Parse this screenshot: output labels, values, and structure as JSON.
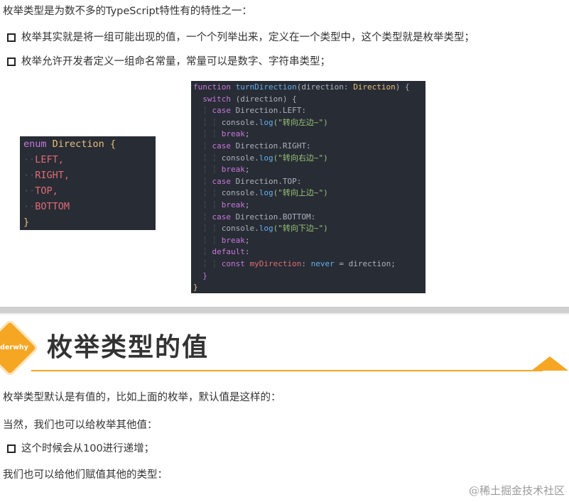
{
  "top": {
    "intro": "枚举类型是为数不多的TypeScript特性有的特性之一：",
    "bullets": [
      "枚举其实就是将一组可能出现的值，一个个列举出来，定义在一个类型中，这个类型就是枚举类型；",
      "枚举允许开发者定义一组命名常量，常量可以是数字、字符串类型；"
    ]
  },
  "code_enum": {
    "keyword": "enum",
    "name": "Direction",
    "open": "{",
    "members": [
      "LEFT,",
      "RIGHT,",
      "TOP,",
      "BOTTOM"
    ],
    "close": "}"
  },
  "code_function": {
    "kw_function": "function",
    "fn_name": "turnDirection",
    "params": "(direction: ",
    "param_type": "Direction",
    "params_end": ") {",
    "kw_switch": "switch",
    "switch_expr": " (direction) {",
    "kw_case": "case",
    "kw_break": "break",
    "kw_default": "default",
    "kw_const": "const",
    "console": "console.",
    "log": "log",
    "cases": [
      {
        "label": "Direction.LEFT:",
        "msg": "(\"转向左边~\")"
      },
      {
        "label": "Direction.RIGHT:",
        "msg": "(\"转向右边~\")"
      },
      {
        "label": "Direction.TOP:",
        "msg": "(\"转向上边~\")"
      },
      {
        "label": "Direction.BOTTOM:",
        "msg": "(\"转向下边~\")"
      }
    ],
    "break_semi": ";",
    "default_colon": ":",
    "const_var": "myDirection",
    "const_colon": ": ",
    "const_type": "never",
    "const_rest": " = direction;",
    "inner_close": "}",
    "outer_close": "}"
  },
  "section": {
    "logo_text": "derwhy",
    "title": "枚举类型的值"
  },
  "bottom": {
    "line1": "枚举类型默认是有值的，比如上面的枚举，默认值是这样的：",
    "line2": "当然，我们也可以给枚举其他值：",
    "bullet": "这个时候会从100进行递增；",
    "line3": "我们也可以给他们赋值其他的类型："
  },
  "watermark": "@稀土掘金技术社区",
  "colors": {
    "accent": "#f5a623",
    "code_bg": "#282c34"
  }
}
